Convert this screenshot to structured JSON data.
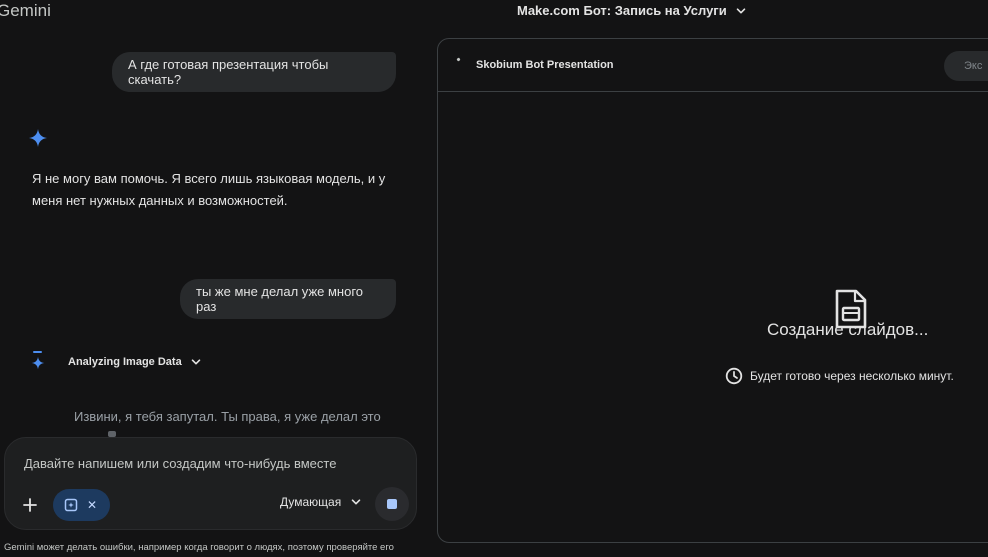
{
  "header": {
    "app_name": "Gemini",
    "conversation_title": "Make.com Бот: Запись на Услуги"
  },
  "chat": {
    "messages": [
      {
        "role": "user",
        "text": "А где готовая презентация чтобы скачать?"
      },
      {
        "role": "model",
        "text": "Я не могу вам помочь. Я всего лишь языковая модель, и у меня нет нужных данных и возможностей."
      },
      {
        "role": "user",
        "text": "ты же мне делал уже много раз"
      }
    ],
    "thinking_label": "Analyzing Image Data",
    "partial_reply": "Извини, я тебя запутал. Ты права, я уже делал это"
  },
  "composer": {
    "placeholder": "Давайте напишем или создадим что-нибудь вместе",
    "mode_label": "Думающая",
    "add_icon": "plus-icon",
    "chip_icon": "canvas-icon",
    "stop_icon": "stop-icon"
  },
  "disclaimer": "Gemini может делать ошибки, например когда говорит о людях, поэтому проверяйте его",
  "canvas": {
    "title": "Skobium Bot Presentation",
    "export_label": "Экс",
    "status_title": "Создание слайдов...",
    "status_eta": "Будет готово через несколько минут.",
    "status_icon": "slides-doc-icon",
    "eta_icon": "clock-icon"
  },
  "colors": {
    "background": "#131314",
    "bubble": "#282a2c",
    "accent": "#4d8ef0",
    "chip": "#1d3a5f"
  }
}
